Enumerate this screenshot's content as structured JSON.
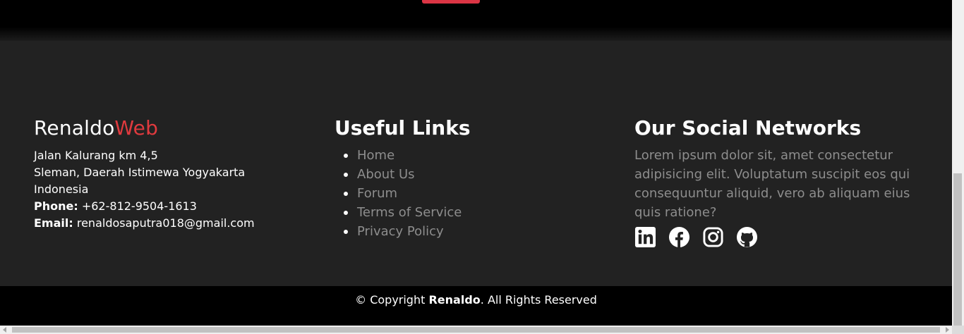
{
  "brand": {
    "name_part1": "Renaldo",
    "name_part2": "Web"
  },
  "address": {
    "line1": "Jalan Kalurang km 4,5",
    "line2": "Sleman, Daerah Istimewa Yogyakarta",
    "line3": "Indonesia",
    "phone_label": "Phone:",
    "phone": "+62-812-9504-1613",
    "email_label": "Email:",
    "email": "renaldosaputra018@gmail.com"
  },
  "useful_links": {
    "title": "Useful Links",
    "items": [
      {
        "label": "Home"
      },
      {
        "label": "About Us"
      },
      {
        "label": "Forum"
      },
      {
        "label": "Terms of Service"
      },
      {
        "label": "Privacy Policy"
      }
    ]
  },
  "social": {
    "title": "Our Social Networks",
    "description": "Lorem ipsum dolor sit, amet consectetur adipisicing elit. Voluptatum suscipit eos qui consequuntur aliquid, vero ab aliquam eius quis ratione?",
    "icons": [
      "linkedin-icon",
      "facebook-icon",
      "instagram-icon",
      "github-icon"
    ]
  },
  "copyright": {
    "prefix": "© Copyright",
    "owner": "Renaldo",
    "suffix": ". All Rights Reserved"
  },
  "colors": {
    "accent": "#e03a3e",
    "footer_bg": "#222222",
    "muted_text": "#8d8d8d",
    "bottom_bar": "#000000"
  }
}
